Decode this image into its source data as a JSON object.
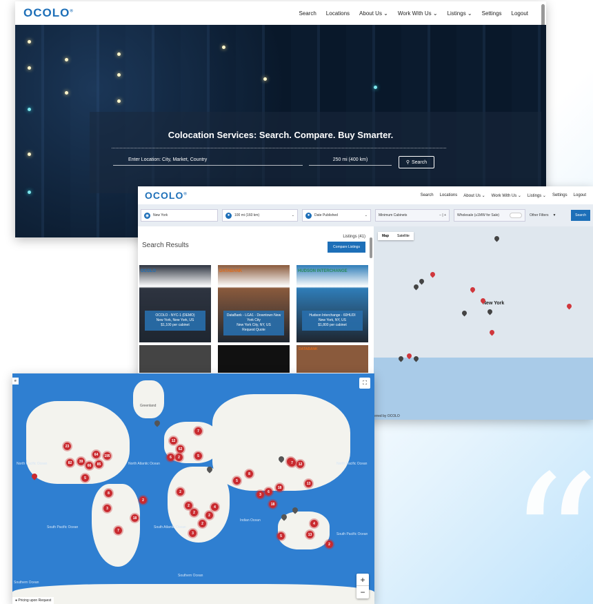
{
  "hero_site": {
    "logo": "OCOLO",
    "nav": [
      "Search",
      "Locations",
      "About Us ⌄",
      "Work With Us ⌄",
      "Listings ⌄",
      "Settings",
      "Logout"
    ],
    "headline": "Colocation Services: Search. Compare. Buy Smarter.",
    "location_placeholder": "Enter Location: City, Market, Country",
    "radius_value": "250 mi (400 km)",
    "search_label": "Search"
  },
  "results_site": {
    "logo": "OCOLO",
    "nav": [
      "Search",
      "Locations",
      "About Us ⌄",
      "Work With Us ⌄",
      "Listings ⌄",
      "Settings",
      "Logout"
    ],
    "filters": {
      "location": "New York",
      "radius": "100 mi (160 km)",
      "date": "Date Published",
      "minimum": "Minimum Cabinets",
      "wholesale": "Wholesale (≥1MW for Sale)",
      "other": "Other Filters",
      "search": "Search"
    },
    "title": "Search Results",
    "listings_count": "Listings (41)",
    "compare_label": "Compare Listings",
    "cards": [
      {
        "brand": "OCOLO",
        "name": "OCOLO - NYC-1 (DEMO)",
        "location": "New York, New York, US",
        "price": "$1,100 per cabinet",
        "bg": "#2e3440",
        "brand_color": "#1d6fb8"
      },
      {
        "brand": "DATABANK",
        "name": "DataBank - LGA1 - Downtown New York City",
        "location": "New York City, NY, US",
        "price": "Request Quote",
        "bg": "#8a5a3c",
        "brand_color": "#e06a1a"
      },
      {
        "brand": "HUDSON INTERCHANGE",
        "name": "Hudson Interchange - 60HUDI",
        "location": "New York, NY, US",
        "price": "$1,800 per cabinet",
        "bg": "#2f7db8",
        "brand_color": "#2a8a5a"
      }
    ],
    "second_row_brands": [
      "",
      "",
      "DATABANK"
    ],
    "map_tabs": [
      "Map",
      "Satellite"
    ],
    "map_label": "New York",
    "credit": "erred by OCOLO"
  },
  "world_map": {
    "ocean_labels": [
      "North Pacific Ocean",
      "North Atlantic Ocean",
      "South Atlantic Ocean",
      "South Pacific Ocean",
      "Indian Ocean",
      "North Pacific Ocean",
      "Southern Ocean",
      "South Pacific Ocean",
      "Southern Ocean"
    ],
    "clusters": [
      "23",
      "82",
      "39",
      "64",
      "195",
      "66",
      "85",
      "5",
      "8",
      "3",
      "7",
      "18",
      "2",
      "12",
      "62",
      "7",
      "6",
      "2",
      "5",
      "2",
      "2",
      "2",
      "4",
      "2",
      "8",
      "5",
      "3",
      "6",
      "18",
      "18",
      "2",
      "7",
      "12",
      "13",
      "5",
      "4",
      "13",
      "2",
      "3",
      "2"
    ],
    "land_labels": [
      "Greenland"
    ],
    "zoom_in": "+",
    "zoom_out": "−",
    "pricing_note": "Pricing upon Request",
    "colors": {
      "cluster": "#c92a2f",
      "ocean": "#2f7fd1",
      "brand": "#1d6fb8"
    }
  }
}
